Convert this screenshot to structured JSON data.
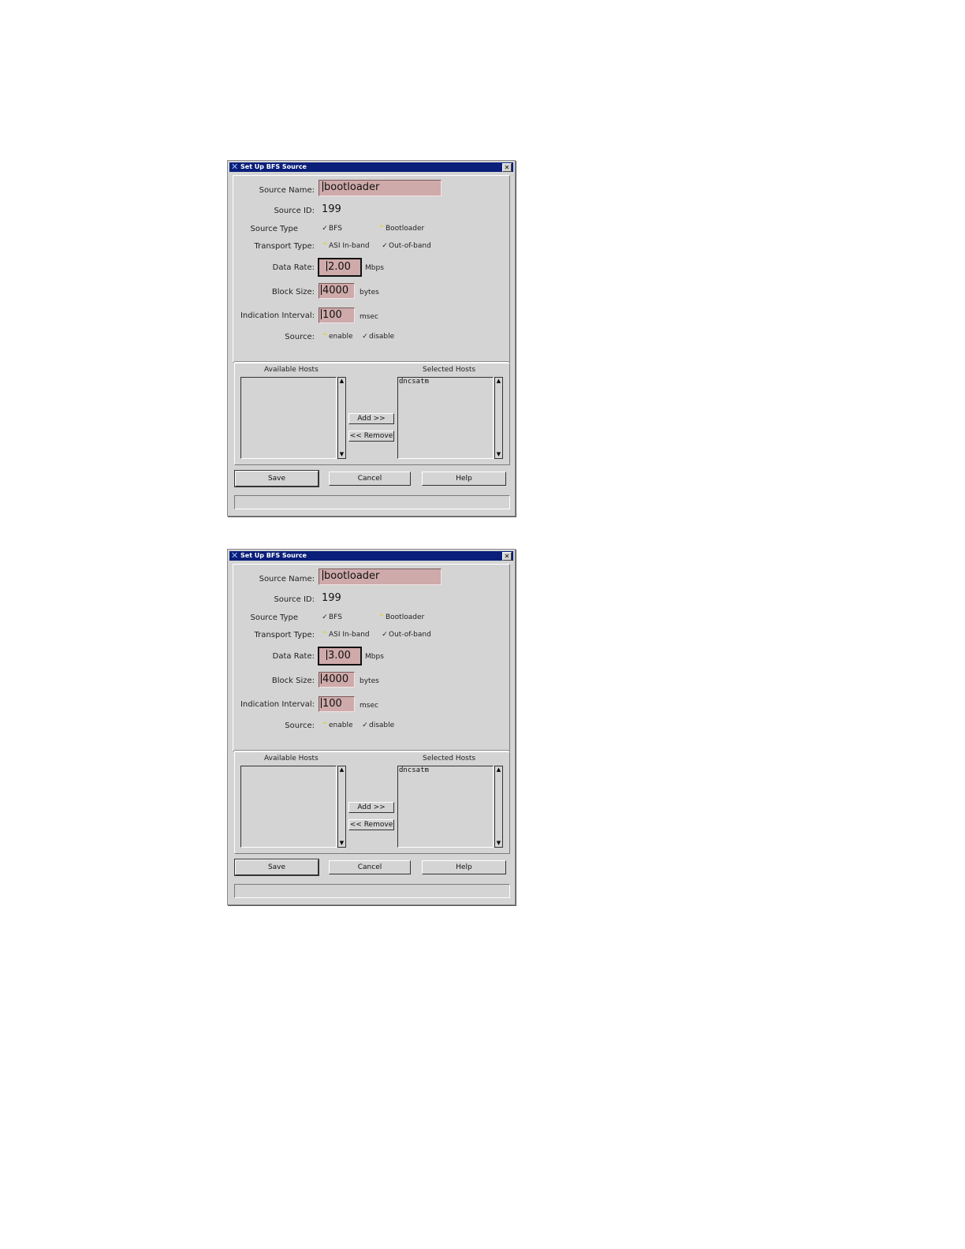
{
  "windows": [
    {
      "title": "Set Up BFS Source",
      "fields": {
        "source_name_label": "Source Name:",
        "source_name_value": "bootloader",
        "source_id_label": "Source ID:",
        "source_id_value": "199",
        "source_type_label": "Source Type",
        "source_type_options": [
          "BFS",
          "Bootloader"
        ],
        "source_type_selected": "Bootloader",
        "transport_type_label": "Transport Type:",
        "transport_type_options": [
          "ASI In-band",
          "Out-of-band"
        ],
        "transport_type_selected": "ASI In-band",
        "data_rate_label": "Data Rate:",
        "data_rate_value": "2.00",
        "data_rate_unit": "Mbps",
        "block_size_label": "Block Size:",
        "block_size_value": "4000",
        "block_size_unit": "bytes",
        "indication_interval_label": "Indication Interval:",
        "indication_interval_value": "100",
        "indication_interval_unit": "msec",
        "source_label": "Source:",
        "source_options": [
          "enable",
          "disable"
        ],
        "source_selected": "enable"
      },
      "hosts": {
        "available_label": "Available Hosts",
        "available_items": [],
        "selected_label": "Selected Hosts",
        "selected_items": [
          "dncsatm"
        ],
        "add_label": "Add >>",
        "remove_label": "<< Remove"
      },
      "buttons": {
        "save": "Save",
        "cancel": "Cancel",
        "help": "Help"
      },
      "status_text": ""
    },
    {
      "title": "Set Up BFS Source",
      "fields": {
        "source_name_label": "Source Name:",
        "source_name_value": "bootloader",
        "source_id_label": "Source ID:",
        "source_id_value": "199",
        "source_type_label": "Source Type",
        "source_type_options": [
          "BFS",
          "Bootloader"
        ],
        "source_type_selected": "Bootloader",
        "transport_type_label": "Transport Type:",
        "transport_type_options": [
          "ASI In-band",
          "Out-of-band"
        ],
        "transport_type_selected": "ASI In-band",
        "data_rate_label": "Data Rate:",
        "data_rate_value": "3.00",
        "data_rate_unit": "Mbps",
        "block_size_label": "Block Size:",
        "block_size_value": "4000",
        "block_size_unit": "bytes",
        "indication_interval_label": "Indication Interval:",
        "indication_interval_value": "100",
        "indication_interval_unit": "msec",
        "source_label": "Source:",
        "source_options": [
          "enable",
          "disable"
        ],
        "source_selected": "enable"
      },
      "hosts": {
        "available_label": "Available Hosts",
        "available_items": [],
        "selected_label": "Selected Hosts",
        "selected_items": [
          "dncsatm"
        ],
        "add_label": "Add >>",
        "remove_label": "<< Remove"
      },
      "buttons": {
        "save": "Save",
        "cancel": "Cancel",
        "help": "Help"
      },
      "status_text": ""
    }
  ],
  "icons": {
    "window_logo": "x-logo-icon",
    "close": "close-icon",
    "radio_on": "diamond-up-icon",
    "radio_off": "checkmark-down-icon",
    "scroll_up": "scroll-up-arrow-icon",
    "scroll_down": "scroll-down-arrow-icon"
  },
  "colors": {
    "titlebar": "#0a1f7a",
    "field_bg": "#cfaaaa",
    "window_bg": "#d4d4d4",
    "radio_on_accent": "#d8d000"
  }
}
